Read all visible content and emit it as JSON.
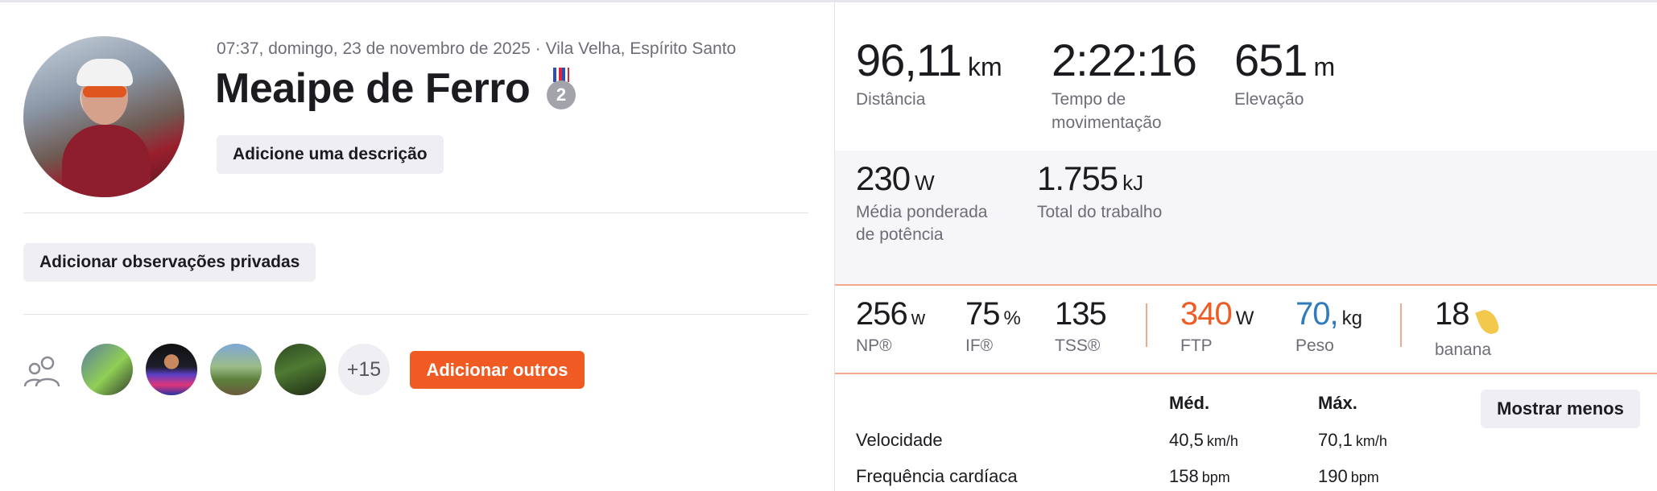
{
  "activity": {
    "meta": "07:37, domingo, 23 de novembro de 2025 · Vila Velha, Espírito Santo",
    "title": "Meaipe de Ferro",
    "medal_rank": "2",
    "add_description": "Adicione uma descrição",
    "add_private_notes": "Adicionar observações privadas"
  },
  "group": {
    "more_count": "+15",
    "add_others": "Adicionar outros"
  },
  "primary_stats": [
    {
      "value": "96,11",
      "unit": "km",
      "label": "Distância"
    },
    {
      "value": "2:22:16",
      "unit": "",
      "label": "Tempo de movimentação"
    },
    {
      "value": "651",
      "unit": "m",
      "label": "Elevação"
    }
  ],
  "power_stats": [
    {
      "value": "230",
      "unit": "W",
      "label": "Média ponderada de potência"
    },
    {
      "value": "1.755",
      "unit": "kJ",
      "label": "Total do trabalho"
    }
  ],
  "training_stats": {
    "np": {
      "value": "256",
      "unit": "w",
      "label": "NP®"
    },
    "if": {
      "value": "75",
      "unit": "%",
      "label": "IF®"
    },
    "tss": {
      "value": "135",
      "unit": "",
      "label": "TSS®"
    },
    "ftp": {
      "value": "340",
      "unit": "W",
      "label": "FTP"
    },
    "weight": {
      "value": "70,",
      "unit": "kg",
      "label": "Peso"
    },
    "banana": {
      "value": "18",
      "label": "banana"
    }
  },
  "table": {
    "col_avg": "Méd.",
    "col_max": "Máx.",
    "show_less": "Mostrar menos",
    "rows": [
      {
        "label": "Velocidade",
        "avg": "40,5",
        "avg_unit": "km/h",
        "max": "70,1",
        "max_unit": "km/h"
      },
      {
        "label": "Frequência cardíaca",
        "avg": "158",
        "avg_unit": "bpm",
        "max": "190",
        "max_unit": "bpm"
      }
    ]
  },
  "colors": {
    "accent": "#f05a23",
    "weight_blue": "#2f7bbd",
    "panel_bg": "#f6f6f8"
  }
}
